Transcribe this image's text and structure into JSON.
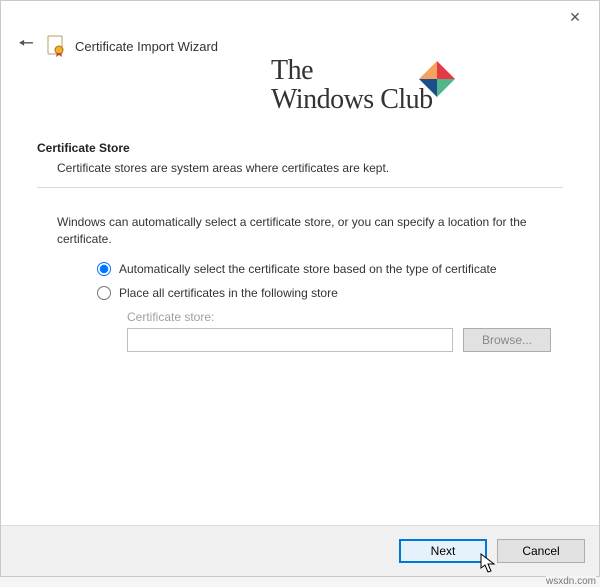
{
  "window": {
    "title": "Certificate Import Wizard",
    "close_tooltip": "Close"
  },
  "watermark": {
    "line1": "The",
    "line2": "Windows Club"
  },
  "section": {
    "heading": "Certificate Store",
    "description": "Certificate stores are system areas where certificates are kept."
  },
  "instruction": "Windows can automatically select a certificate store, or you can specify a location for the certificate.",
  "options": {
    "auto": "Automatically select the certificate store based on the type of certificate",
    "manual": "Place all certificates in the following store"
  },
  "store": {
    "label": "Certificate store:",
    "value": "",
    "browse": "Browse..."
  },
  "buttons": {
    "next": "Next",
    "cancel": "Cancel"
  },
  "credit": "wsxdn.com"
}
